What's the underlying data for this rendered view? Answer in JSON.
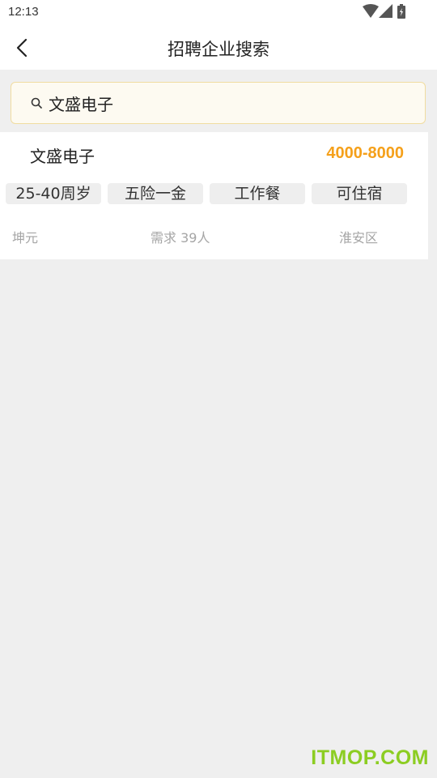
{
  "status_bar": {
    "time": "12:13",
    "icons": [
      "wifi-icon",
      "signal-icon",
      "battery-icon"
    ]
  },
  "nav": {
    "title": "招聘企业搜索",
    "back_icon": "chevron-left-icon"
  },
  "search": {
    "value": "文盛电子",
    "icon": "search-icon"
  },
  "results": [
    {
      "company": "文盛电子",
      "salary": "4000-8000",
      "tags": [
        "25-40周岁",
        "五险一金",
        "工作餐",
        "可住宿"
      ],
      "contact": "坤元",
      "demand": "需求 39人",
      "district": "淮安区"
    }
  ],
  "watermark": "ITMOP.COM",
  "colors": {
    "accent": "#f5a01a",
    "background": "#efefef",
    "watermark": "#8ccd22"
  }
}
